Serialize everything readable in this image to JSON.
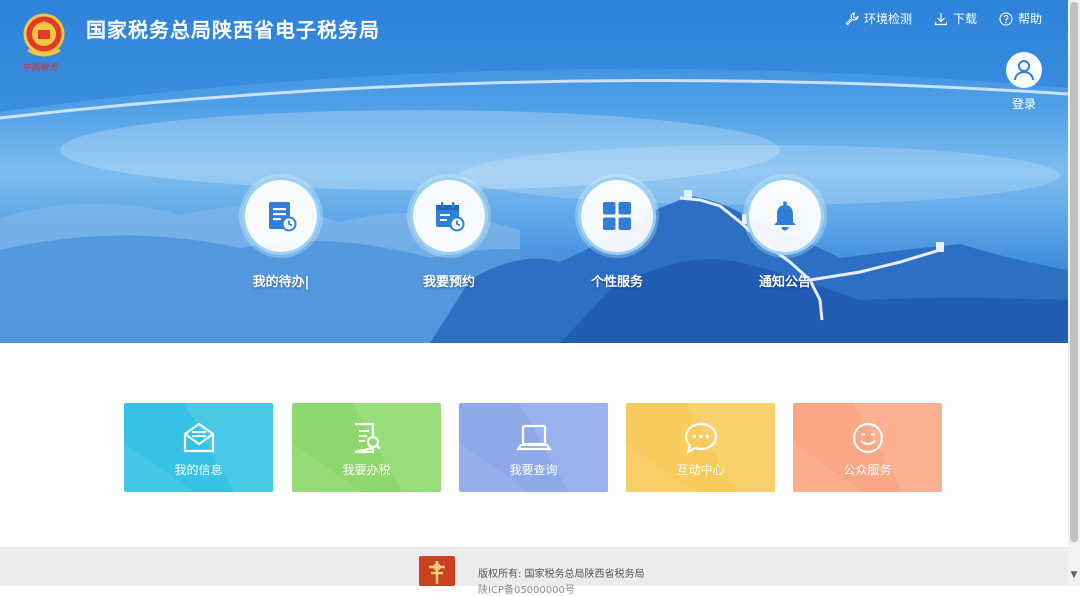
{
  "site": {
    "title": "国家税务总局陕西省电子税务局",
    "emblem_caption": "中国税务"
  },
  "topnav": [
    {
      "label": "环境检测",
      "icon": "wrench-icon"
    },
    {
      "label": "下载",
      "icon": "download-icon"
    },
    {
      "label": "帮助",
      "icon": "help-icon"
    }
  ],
  "login": {
    "label": "登录",
    "icon": "user-icon"
  },
  "quick_actions": [
    {
      "label": "我的待办|",
      "icon": "todo-list-icon"
    },
    {
      "label": "我要预约",
      "icon": "calendar-clock-icon"
    },
    {
      "label": "个性服务",
      "icon": "grid-icon"
    },
    {
      "label": "通知公告",
      "icon": "bell-icon"
    }
  ],
  "tiles": [
    {
      "label": "我的信息",
      "icon": "envelope-icon",
      "color": "#35c2e6"
    },
    {
      "label": "我要办税",
      "icon": "document-search-icon",
      "color": "#8ed96d"
    },
    {
      "label": "我要查询",
      "icon": "laptop-icon",
      "color": "#8ea9ea"
    },
    {
      "label": "互动中心",
      "icon": "chat-bubble-icon",
      "color": "#f8cc5c"
    },
    {
      "label": "公众服务",
      "icon": "smiley-icon",
      "color": "#fba786"
    }
  ],
  "footer": {
    "copyright": "版权所有: 国家税务总局陕西省税务局",
    "icp": "陕ICP备05000000号"
  },
  "colors": {
    "hero_blue": "#2f86dc",
    "icon_blue": "#2f7fd8",
    "footer_bg": "#ececec"
  }
}
